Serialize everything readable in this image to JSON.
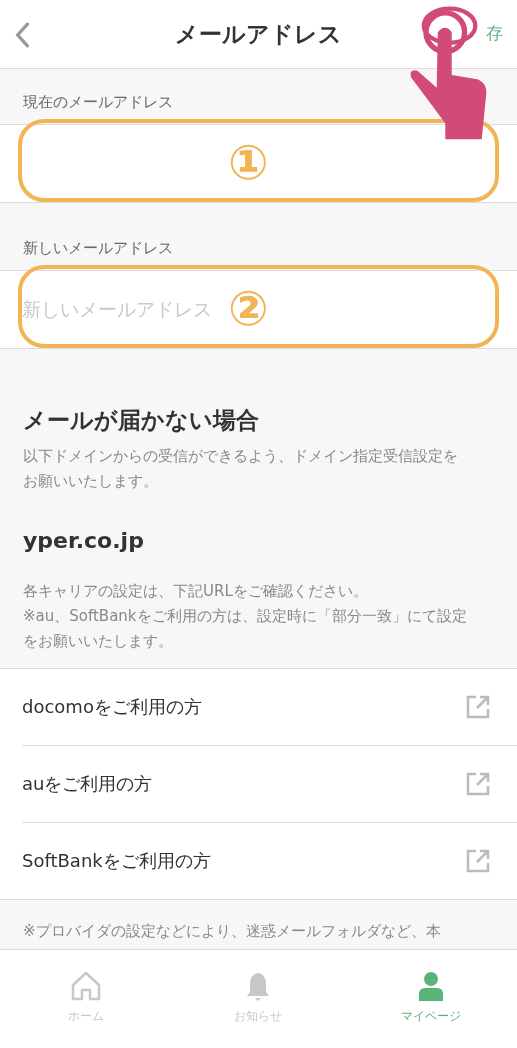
{
  "header": {
    "title": "メールアドレス",
    "save_label": "存"
  },
  "fields": [
    {
      "label": "現在のメールアドレス",
      "marker": "①"
    },
    {
      "label": "新しいメールアドレス",
      "placeholder": "新しいメールアドレス",
      "marker": "②"
    }
  ],
  "help": {
    "heading": "メールが届かない場合",
    "intro": "以下ドメインからの受信ができるよう、ドメイン指定受信設定をお願いいたします。",
    "domain": "yper.co.jp",
    "note": "各キャリアの設定は、下記URLをご確認ください。\n※au、SoftBankをご利用の方は、設定時に「部分一致」にて設定をお願いいたします。"
  },
  "carrier_links": [
    {
      "label": "docomoをご利用の方"
    },
    {
      "label": "auをご利用の方"
    },
    {
      "label": "SoftBankをご利用の方"
    }
  ],
  "footer_note": "※プロバイダの設定などにより、迷惑メールフォルダなど、本",
  "tabs": [
    {
      "kind": "home",
      "label": "ホーム",
      "selected": false
    },
    {
      "kind": "bell",
      "label": "お知らせ",
      "selected": false
    },
    {
      "kind": "person",
      "label": "マイページ",
      "selected": true
    }
  ]
}
